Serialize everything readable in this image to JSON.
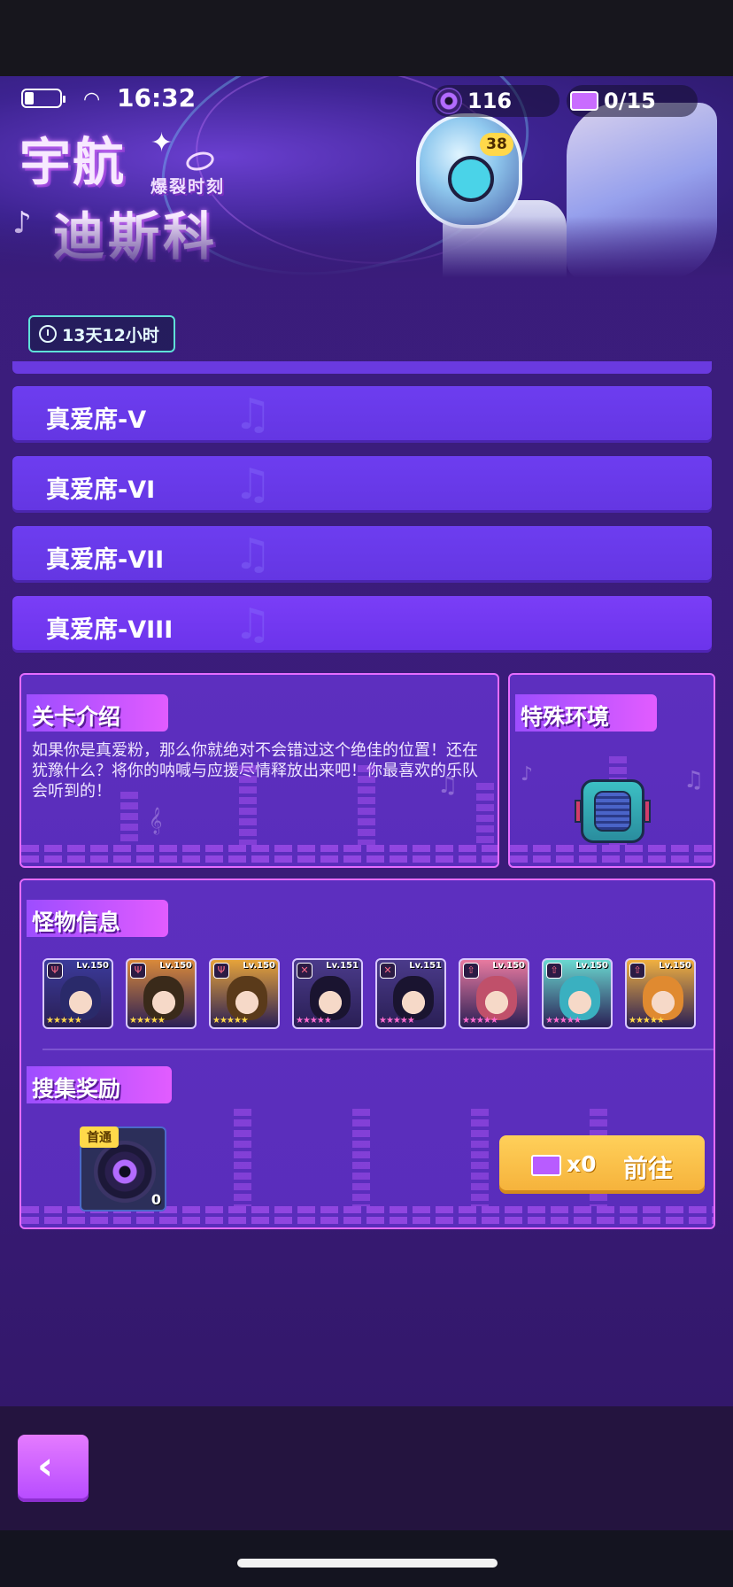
{
  "status_bar": {
    "time": "16:32"
  },
  "resources": {
    "discs": {
      "icon": "disc-icon",
      "value": "116"
    },
    "tickets": {
      "icon": "ticket-icon",
      "value": "0/15"
    }
  },
  "banner": {
    "title_line1": "宇航",
    "title_line2": "迪斯科",
    "subtitle": "爆裂时刻",
    "mascot_level": "38"
  },
  "timer": {
    "icon": "clock-icon",
    "text": "13天12小时"
  },
  "seats": [
    {
      "label": "真爱席-V"
    },
    {
      "label": "真爱席-VI"
    },
    {
      "label": "真爱席-VII"
    },
    {
      "label": "真爱席-VIII"
    }
  ],
  "intro": {
    "title": "关卡介绍",
    "text": "如果你是真爱粉，那么你就绝对不会错过这个绝佳的位置！还在犹豫什么？将你的呐喊与应援尽情释放出来吧！你最喜欢的乐队会听到的！"
  },
  "environment": {
    "title": "特殊环境",
    "icon": "speaker-icon"
  },
  "monsters": {
    "title": "怪物信息",
    "items": [
      {
        "level": "Lv.150",
        "class_icon": "tank-icon",
        "stars": "★★★★★",
        "star_color": "#ffd84a",
        "color": "#3b3a9a",
        "hair": "#2a2a6a"
      },
      {
        "level": "Lv.150",
        "class_icon": "tank-icon",
        "stars": "★★★★★",
        "star_color": "#ffd84a",
        "color": "#d9893a",
        "hair": "#3a2a1a"
      },
      {
        "level": "Lv.150",
        "class_icon": "tank-icon",
        "stars": "★★★★★",
        "star_color": "#ffd84a",
        "color": "#e6a33a",
        "hair": "#5a3a1a"
      },
      {
        "level": "Lv.151",
        "class_icon": "sword-icon",
        "stars": "★★★★★",
        "star_color": "#ff6bd0",
        "color": "#4a3a8a",
        "hair": "#1a1430"
      },
      {
        "level": "Lv.151",
        "class_icon": "sword-icon",
        "stars": "★★★★★",
        "star_color": "#ff6bd0",
        "color": "#4a3a8a",
        "hair": "#1a1430"
      },
      {
        "level": "Lv.150",
        "class_icon": "support-icon",
        "stars": "★★★★★",
        "star_color": "#ff6bd0",
        "color": "#e87aa0",
        "hair": "#c0506a"
      },
      {
        "level": "Lv.150",
        "class_icon": "support-icon",
        "stars": "★★★★★",
        "star_color": "#ff6bd0",
        "color": "#6ad8d0",
        "hair": "#3ab0c0"
      },
      {
        "level": "Lv.150",
        "class_icon": "support-icon",
        "stars": "★★★★★",
        "star_color": "#ffd84a",
        "color": "#f0b040",
        "hair": "#e08a30"
      }
    ]
  },
  "rewards": {
    "title": "搜集奖励",
    "item": {
      "icon": "record-disc-icon",
      "badge": "首通",
      "count": "0"
    },
    "go_button": {
      "icon": "ticket-icon",
      "quantity": "x0",
      "label": "前往"
    }
  },
  "nav": {
    "back_icon": "back-chevron-icon"
  }
}
